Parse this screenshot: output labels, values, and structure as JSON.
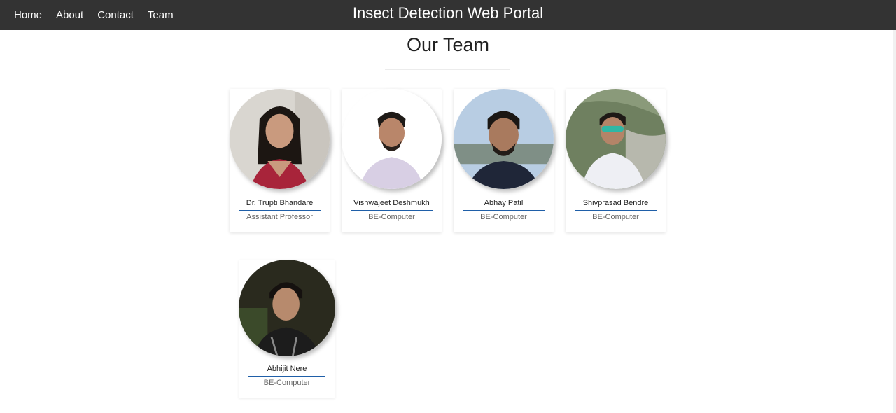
{
  "nav": {
    "links": [
      {
        "label": "Home"
      },
      {
        "label": "About"
      },
      {
        "label": "Contact"
      },
      {
        "label": "Team"
      }
    ],
    "site_title": "Insect Detection Web Portal"
  },
  "main": {
    "heading": "Our Team",
    "members": [
      {
        "name": "Dr. Trupti Bhandare",
        "role": "Assistant Professor"
      },
      {
        "name": "Vishwajeet Deshmukh",
        "role": "BE-Computer"
      },
      {
        "name": "Abhay Patil",
        "role": "BE-Computer"
      },
      {
        "name": "Shivprasad Bendre",
        "role": "BE-Computer"
      },
      {
        "name": "Abhijit Nere",
        "role": "BE-Computer"
      }
    ]
  },
  "colors": {
    "navbar": "#333333",
    "accent_rule": "#1f5fa8"
  }
}
